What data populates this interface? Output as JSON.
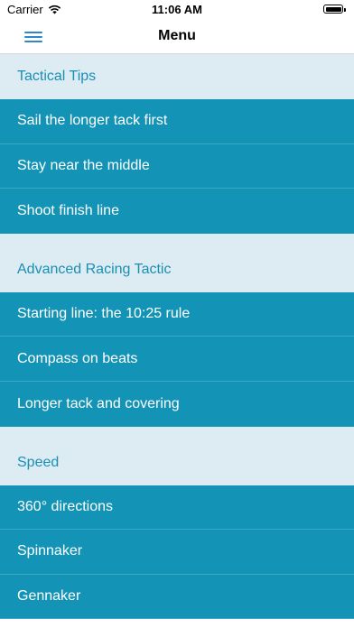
{
  "status_bar": {
    "carrier": "Carrier",
    "time": "11:06 AM"
  },
  "nav": {
    "title": "Menu",
    "menu_icon": "hamburger-icon"
  },
  "sections": [
    {
      "title": "Tactical Tips",
      "items": [
        "Sail the longer tack first",
        "Stay near the middle",
        "Shoot finish line"
      ]
    },
    {
      "title": "Advanced Racing Tactic",
      "items": [
        "Starting line: the 10:25 rule",
        "Compass on beats",
        "Longer tack and covering"
      ]
    },
    {
      "title": "Speed",
      "items": [
        "360° directions",
        "Spinnaker",
        "Gennaker"
      ]
    }
  ],
  "colors": {
    "accent": "#2f87c9",
    "item_bg": "#1394b6",
    "header_bg": "#dcecf2",
    "header_text": "#1a8fb4"
  }
}
